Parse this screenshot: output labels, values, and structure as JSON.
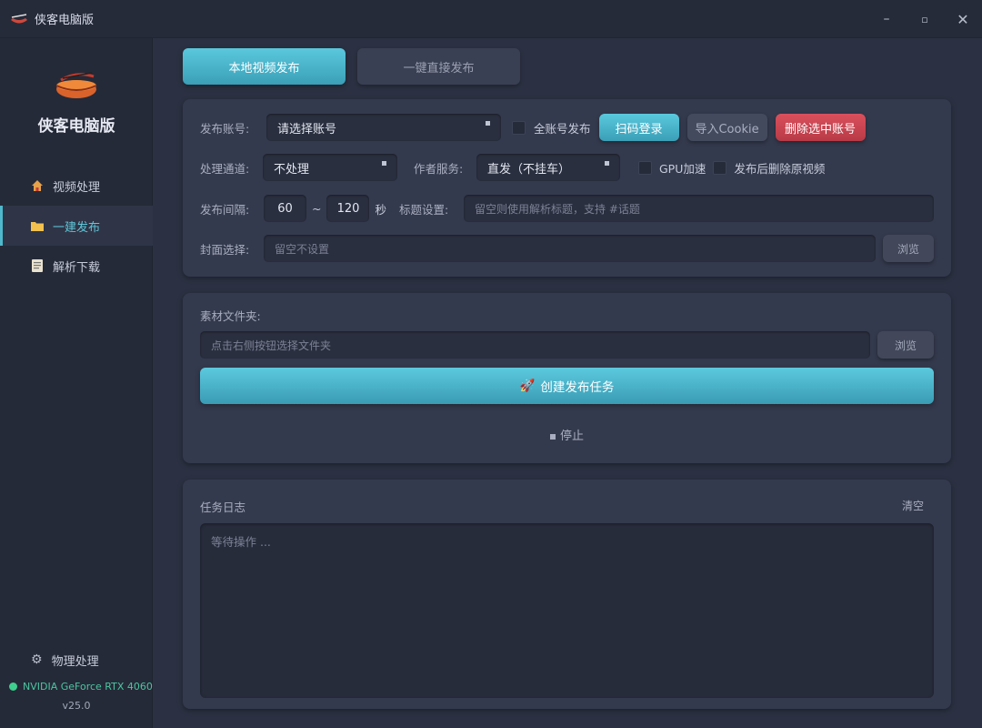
{
  "window": {
    "title": "侠客电脑版",
    "controls": [
      "minimize",
      "maximize",
      "close"
    ]
  },
  "sidebar": {
    "logo_text": "侠客电脑版",
    "items": [
      {
        "label": "视频处理",
        "icon": "home-icon"
      },
      {
        "label": "一建发布",
        "icon": "folder-icon"
      },
      {
        "label": "解析下载",
        "icon": "document-icon"
      }
    ],
    "bottom_item": {
      "label": "物理处理",
      "icon": "gear-icon"
    },
    "gpu_status": "NVIDIA GeForce RTX 4060",
    "version": "v25.0"
  },
  "tabs": [
    {
      "label": "本地视频发布",
      "active": true
    },
    {
      "label": "一键直接发布",
      "active": false
    }
  ],
  "publish_form": {
    "account_label": "发布账号:",
    "account_value": "请选择账号",
    "all_accounts_label": "全账号发布",
    "scan_login": "扫码登录",
    "import_cookie": "导入Cookie",
    "delete_account": "删除选中账号",
    "channel_label": "处理通道:",
    "channel_value": "不处理",
    "author_service_label": "作者服务:",
    "author_service_value": "直发（不挂车）",
    "gpu_accel_label": "GPU加速",
    "delete_after_label": "发布后删除原视频",
    "interval_label": "发布间隔:",
    "interval_min": "60",
    "interval_sep": "~",
    "interval_max": "120",
    "interval_unit": "秒",
    "title_label": "标题设置:",
    "title_placeholder": "留空则使用解析标题，支持 #话题",
    "cover_label": "封面选择:",
    "cover_placeholder": "留空不设置",
    "browse": "浏览"
  },
  "material": {
    "label": "素材文件夹:",
    "placeholder": "点击右侧按钮选择文件夹",
    "browse": "浏览",
    "create_task": "创建发布任务",
    "stop": "停止"
  },
  "log": {
    "title": "任务日志",
    "clear": "清空",
    "content": "等待操作 ..."
  },
  "colors": {
    "accent": "#4fb8cc",
    "danger": "#c8434f",
    "gpu_ok": "#3ecf8e"
  }
}
